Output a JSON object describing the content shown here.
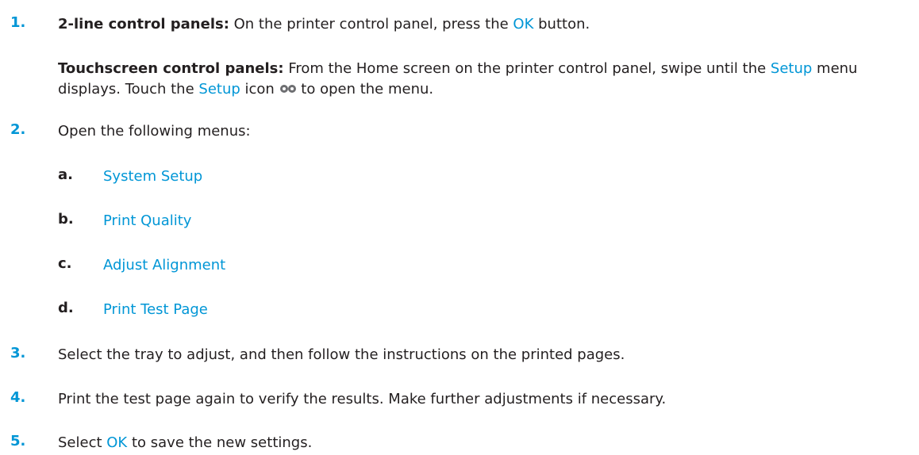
{
  "steps": [
    {
      "number": "1.",
      "line1_bold": "2-line control panels:",
      "line1_a": " On the printer control panel, press the ",
      "line1_ok": "OK",
      "line1_b": " button.",
      "touch_bold": "Touchscreen control panels:",
      "touch_a": " From the Home screen on the printer control panel, swipe until the ",
      "touch_setup1": "Setup",
      "touch_b": " menu displays. Touch the ",
      "touch_setup2": "Setup",
      "touch_c": " icon ",
      "touch_d": " to open the menu."
    },
    {
      "number": "2.",
      "text": "Open the following menus:"
    },
    {
      "number": "3.",
      "text": "Select the tray to adjust, and then follow the instructions on the printed pages."
    },
    {
      "number": "4.",
      "text": "Print the test page again to verify the results. Make further adjustments if necessary."
    },
    {
      "number": "5.",
      "text_a": "Select ",
      "ok": "OK",
      "text_b": " to save the new settings."
    }
  ],
  "submenus": [
    {
      "letter": "a.",
      "label": "System Setup"
    },
    {
      "letter": "b.",
      "label": "Print Quality"
    },
    {
      "letter": "c.",
      "label": "Adjust Alignment"
    },
    {
      "letter": "d.",
      "label": "Print Test Page"
    }
  ],
  "icons": {
    "setup": "gear-icon"
  },
  "colors": {
    "accent": "#0096d6",
    "text": "#231f20"
  }
}
